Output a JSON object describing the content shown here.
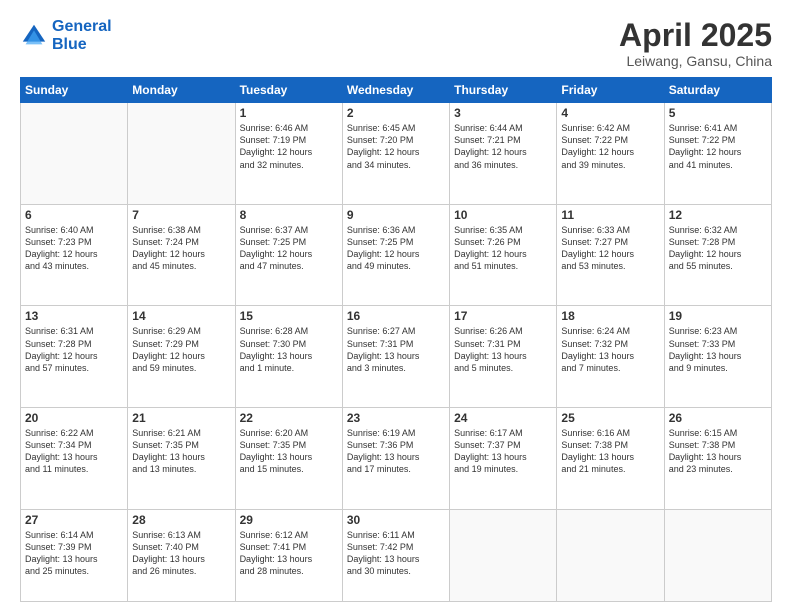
{
  "header": {
    "logo_line1": "General",
    "logo_line2": "Blue",
    "month": "April 2025",
    "location": "Leiwang, Gansu, China"
  },
  "days_of_week": [
    "Sunday",
    "Monday",
    "Tuesday",
    "Wednesday",
    "Thursday",
    "Friday",
    "Saturday"
  ],
  "weeks": [
    [
      {
        "day": "",
        "info": ""
      },
      {
        "day": "",
        "info": ""
      },
      {
        "day": "1",
        "info": "Sunrise: 6:46 AM\nSunset: 7:19 PM\nDaylight: 12 hours\nand 32 minutes."
      },
      {
        "day": "2",
        "info": "Sunrise: 6:45 AM\nSunset: 7:20 PM\nDaylight: 12 hours\nand 34 minutes."
      },
      {
        "day": "3",
        "info": "Sunrise: 6:44 AM\nSunset: 7:21 PM\nDaylight: 12 hours\nand 36 minutes."
      },
      {
        "day": "4",
        "info": "Sunrise: 6:42 AM\nSunset: 7:22 PM\nDaylight: 12 hours\nand 39 minutes."
      },
      {
        "day": "5",
        "info": "Sunrise: 6:41 AM\nSunset: 7:22 PM\nDaylight: 12 hours\nand 41 minutes."
      }
    ],
    [
      {
        "day": "6",
        "info": "Sunrise: 6:40 AM\nSunset: 7:23 PM\nDaylight: 12 hours\nand 43 minutes."
      },
      {
        "day": "7",
        "info": "Sunrise: 6:38 AM\nSunset: 7:24 PM\nDaylight: 12 hours\nand 45 minutes."
      },
      {
        "day": "8",
        "info": "Sunrise: 6:37 AM\nSunset: 7:25 PM\nDaylight: 12 hours\nand 47 minutes."
      },
      {
        "day": "9",
        "info": "Sunrise: 6:36 AM\nSunset: 7:25 PM\nDaylight: 12 hours\nand 49 minutes."
      },
      {
        "day": "10",
        "info": "Sunrise: 6:35 AM\nSunset: 7:26 PM\nDaylight: 12 hours\nand 51 minutes."
      },
      {
        "day": "11",
        "info": "Sunrise: 6:33 AM\nSunset: 7:27 PM\nDaylight: 12 hours\nand 53 minutes."
      },
      {
        "day": "12",
        "info": "Sunrise: 6:32 AM\nSunset: 7:28 PM\nDaylight: 12 hours\nand 55 minutes."
      }
    ],
    [
      {
        "day": "13",
        "info": "Sunrise: 6:31 AM\nSunset: 7:28 PM\nDaylight: 12 hours\nand 57 minutes."
      },
      {
        "day": "14",
        "info": "Sunrise: 6:29 AM\nSunset: 7:29 PM\nDaylight: 12 hours\nand 59 minutes."
      },
      {
        "day": "15",
        "info": "Sunrise: 6:28 AM\nSunset: 7:30 PM\nDaylight: 13 hours\nand 1 minute."
      },
      {
        "day": "16",
        "info": "Sunrise: 6:27 AM\nSunset: 7:31 PM\nDaylight: 13 hours\nand 3 minutes."
      },
      {
        "day": "17",
        "info": "Sunrise: 6:26 AM\nSunset: 7:31 PM\nDaylight: 13 hours\nand 5 minutes."
      },
      {
        "day": "18",
        "info": "Sunrise: 6:24 AM\nSunset: 7:32 PM\nDaylight: 13 hours\nand 7 minutes."
      },
      {
        "day": "19",
        "info": "Sunrise: 6:23 AM\nSunset: 7:33 PM\nDaylight: 13 hours\nand 9 minutes."
      }
    ],
    [
      {
        "day": "20",
        "info": "Sunrise: 6:22 AM\nSunset: 7:34 PM\nDaylight: 13 hours\nand 11 minutes."
      },
      {
        "day": "21",
        "info": "Sunrise: 6:21 AM\nSunset: 7:35 PM\nDaylight: 13 hours\nand 13 minutes."
      },
      {
        "day": "22",
        "info": "Sunrise: 6:20 AM\nSunset: 7:35 PM\nDaylight: 13 hours\nand 15 minutes."
      },
      {
        "day": "23",
        "info": "Sunrise: 6:19 AM\nSunset: 7:36 PM\nDaylight: 13 hours\nand 17 minutes."
      },
      {
        "day": "24",
        "info": "Sunrise: 6:17 AM\nSunset: 7:37 PM\nDaylight: 13 hours\nand 19 minutes."
      },
      {
        "day": "25",
        "info": "Sunrise: 6:16 AM\nSunset: 7:38 PM\nDaylight: 13 hours\nand 21 minutes."
      },
      {
        "day": "26",
        "info": "Sunrise: 6:15 AM\nSunset: 7:38 PM\nDaylight: 13 hours\nand 23 minutes."
      }
    ],
    [
      {
        "day": "27",
        "info": "Sunrise: 6:14 AM\nSunset: 7:39 PM\nDaylight: 13 hours\nand 25 minutes."
      },
      {
        "day": "28",
        "info": "Sunrise: 6:13 AM\nSunset: 7:40 PM\nDaylight: 13 hours\nand 26 minutes."
      },
      {
        "day": "29",
        "info": "Sunrise: 6:12 AM\nSunset: 7:41 PM\nDaylight: 13 hours\nand 28 minutes."
      },
      {
        "day": "30",
        "info": "Sunrise: 6:11 AM\nSunset: 7:42 PM\nDaylight: 13 hours\nand 30 minutes."
      },
      {
        "day": "",
        "info": ""
      },
      {
        "day": "",
        "info": ""
      },
      {
        "day": "",
        "info": ""
      }
    ]
  ]
}
